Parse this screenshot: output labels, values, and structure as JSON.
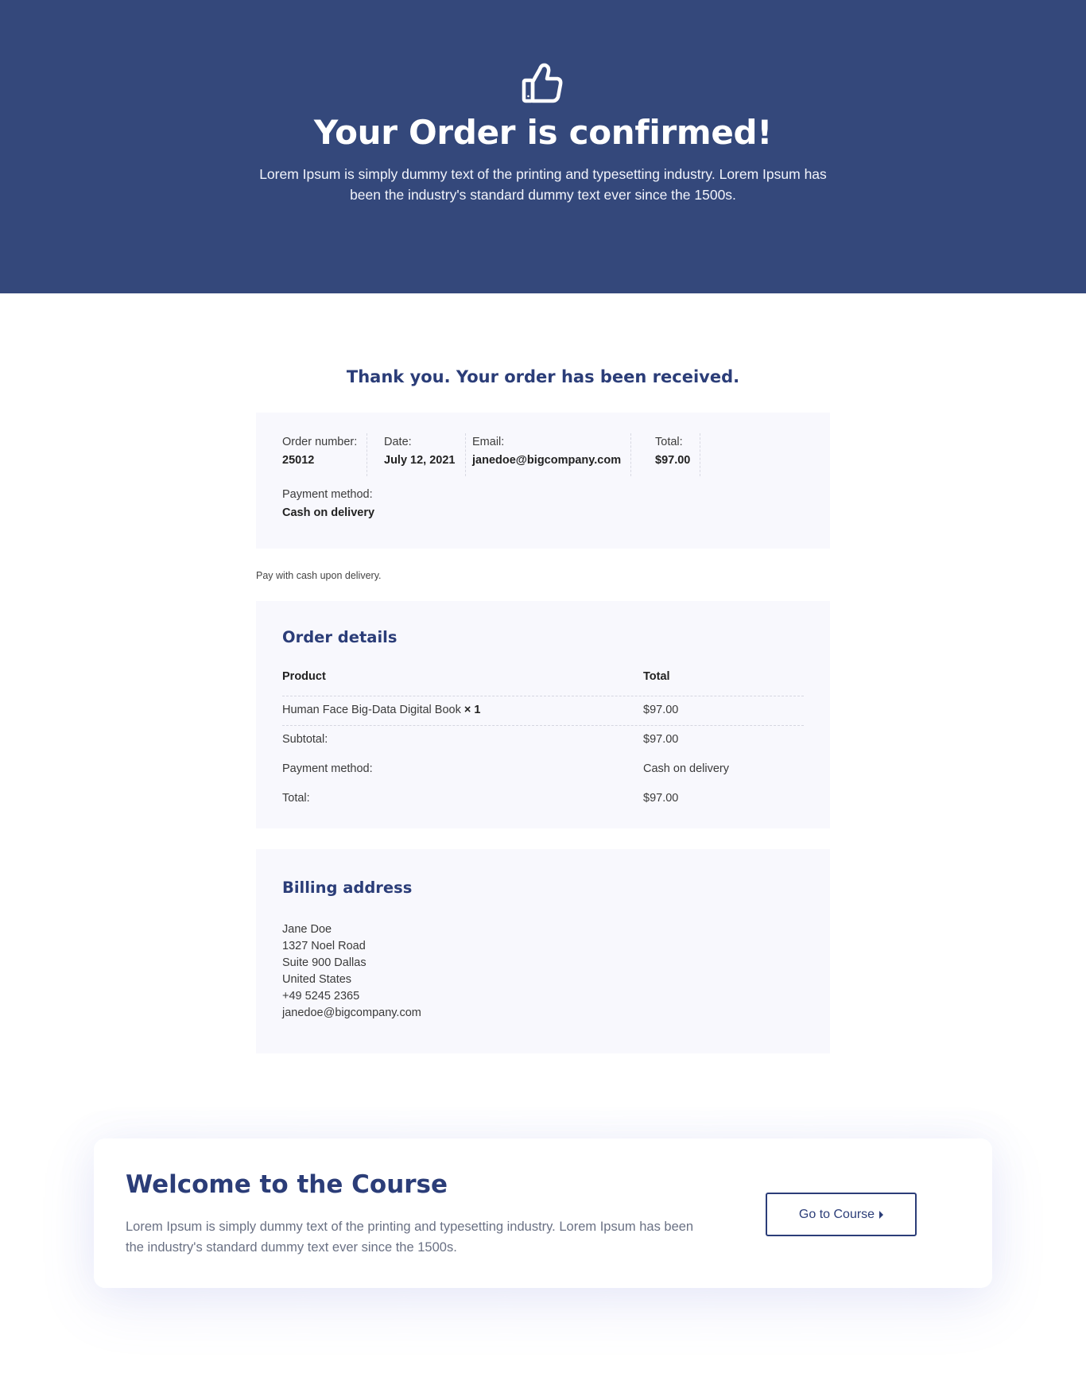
{
  "hero": {
    "icon": "thumbs-up-icon",
    "title": "Your Order is confirmed!",
    "subtitle": "Lorem Ipsum is simply dummy text of the printing and typesetting industry. Lorem Ipsum has been the industry's standard dummy text ever since the 1500s.",
    "background": "#34487b"
  },
  "main": {
    "thank_you": "Thank you. Your order has been received.",
    "overview": {
      "order_number_label": "Order number:",
      "order_number": "25012",
      "date_label": "Date:",
      "date": "July 12, 2021",
      "email_label": "Email:",
      "email": "janedoe@bigcompany.com",
      "total_label": "Total:",
      "total": "$97.00",
      "payment_label": "Payment method:",
      "payment": "Cash on delivery"
    },
    "payment_note": "Pay with cash upon delivery.",
    "order_details": {
      "heading": "Order details",
      "col_product": "Product",
      "col_total": "Total",
      "item_name": "Human Face Big-Data Digital Book",
      "item_qty": "× 1",
      "item_total": "$97.00",
      "subtotal_label": "Subtotal:",
      "subtotal": "$97.00",
      "payment_label": "Payment method:",
      "payment": "Cash on delivery",
      "total_label": "Total:",
      "total": "$97.00"
    },
    "billing": {
      "heading": "Billing address",
      "name": "Jane Doe",
      "street": "1327 Noel Road",
      "suite": "Suite 900 Dallas",
      "country": "United States",
      "phone": "+49 5245 2365",
      "email": "janedoe@bigcompany.com"
    }
  },
  "welcome": {
    "title": "Welcome to the Course",
    "text": "Lorem Ipsum is simply dummy text of the printing and typesetting industry. Lorem Ipsum has been the industry's standard dummy text ever since the 1500s.",
    "button_label": "Go to Course",
    "button_icon": "caret-right-icon"
  },
  "colors": {
    "accent": "#2b3d78",
    "panel_bg": "#f8f8fd"
  }
}
